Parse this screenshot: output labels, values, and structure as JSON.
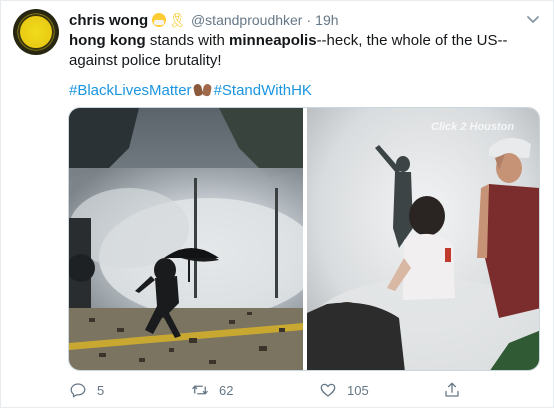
{
  "tweet": {
    "author_name": "chris wong",
    "handle": "@standproudhker",
    "separator": "·",
    "time": "19h",
    "text_part1": "hong kong",
    "text_part2": " stands with ",
    "text_part3": "minneapolis",
    "text_part4": "--heck, the whole of the US--against police brutality!",
    "hashtag1": "#BlackLivesMatter",
    "hashtag2": "#StandWithHK",
    "watermark": "Click 2 Houston",
    "reply_count": "5",
    "retweet_count": "62",
    "like_count": "105"
  },
  "icons": {
    "avatar": "avatar-logo",
    "caret": "chevron-down-icon",
    "reply": "reply-icon",
    "retweet": "retweet-icon",
    "like": "heart-icon",
    "share": "share-icon"
  },
  "colors": {
    "link": "#1b95e0",
    "muted": "#657786",
    "text": "#14171a"
  }
}
